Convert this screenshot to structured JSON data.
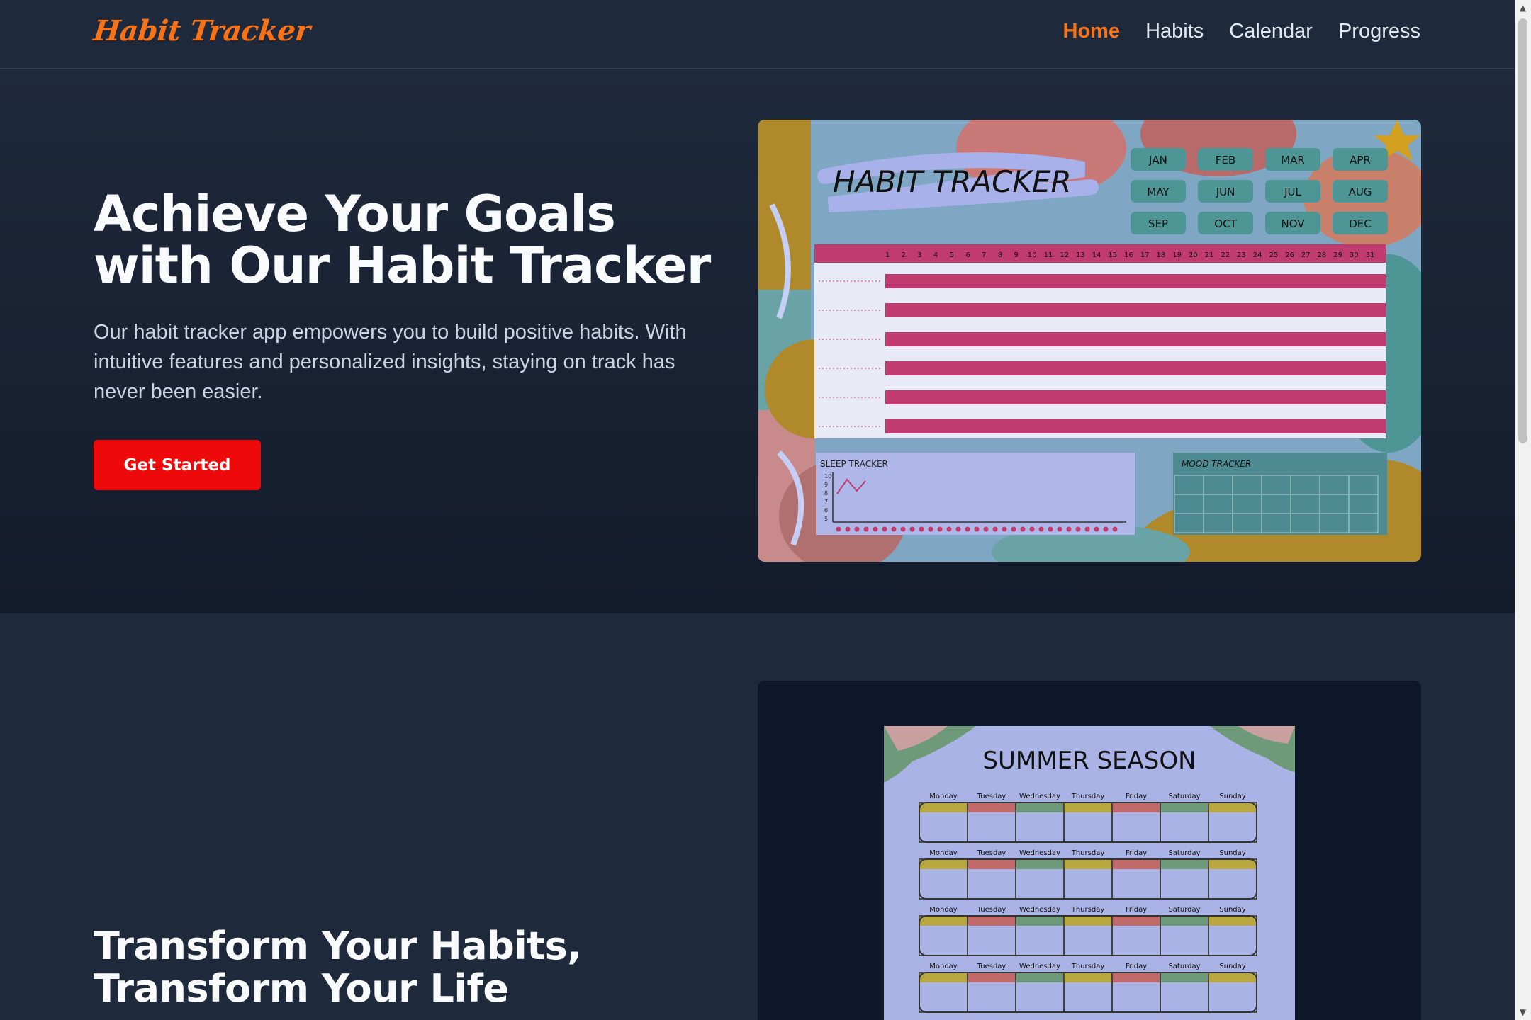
{
  "header": {
    "logo": "Habit Tracker",
    "nav": [
      {
        "label": "Home",
        "active": true
      },
      {
        "label": "Habits",
        "active": false
      },
      {
        "label": "Calendar",
        "active": false
      },
      {
        "label": "Progress",
        "active": false
      }
    ]
  },
  "hero": {
    "title": "Achieve Your Goals with Our Habit Tracker",
    "description": "Our habit tracker app empowers you to build positive habits. With intuitive features and personalized insights, staying on track has never been easier.",
    "cta_label": "Get Started",
    "image": {
      "title": "HABIT TRACKER",
      "months": [
        "JAN",
        "FEB",
        "MAR",
        "APR",
        "MAY",
        "JUN",
        "JUL",
        "AUG",
        "SEP",
        "OCT",
        "NOV",
        "DEC"
      ],
      "days": [
        "1",
        "2",
        "3",
        "4",
        "5",
        "6",
        "7",
        "8",
        "9",
        "10",
        "11",
        "12",
        "13",
        "14",
        "15",
        "16",
        "17",
        "18",
        "19",
        "20",
        "21",
        "22",
        "23",
        "24",
        "25",
        "26",
        "27",
        "28",
        "29",
        "30",
        "31"
      ],
      "sleep_label": "SLEEP TRACKER",
      "sleep_scale": [
        "10",
        "9",
        "8",
        "7",
        "6",
        "5"
      ],
      "mood_label": "MOOD TRACKER"
    }
  },
  "section2": {
    "title": "Transform Your Habits, Transform Your Life",
    "image": {
      "title": "SUMMER SEASON",
      "weekdays": [
        "Monday",
        "Tuesday",
        "Wednesday",
        "Thursday",
        "Friday",
        "Saturday",
        "Sunday"
      ]
    }
  },
  "colors": {
    "accent": "#f97316",
    "cta": "#ee0a0a",
    "background": "#1e293b"
  }
}
